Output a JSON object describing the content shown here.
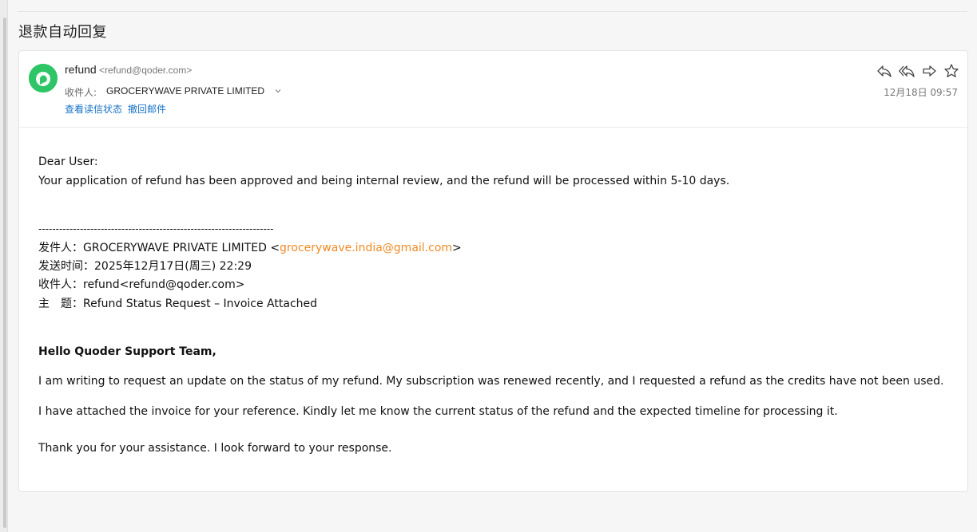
{
  "subject": "退款自动回复",
  "header": {
    "sender_name": "refund",
    "sender_address": "<refund@qoder.com>",
    "to_label": "收件人:",
    "to_value": "GROCERYWAVE PRIVATE LIMITED",
    "read_status_link": "查看读信状态",
    "recall_link": "撤回邮件",
    "date": "12月18日 09:57",
    "avatar_color": "#2ec567",
    "actions": [
      "reply-icon",
      "reply-all-icon",
      "forward-icon",
      "star-icon"
    ]
  },
  "body": {
    "greeting": "Dear User:",
    "message": "Your application of refund has been approved and being internal review, and the refund will be processed within 5-10 days.",
    "separator": "--------------------------------------------------------------------",
    "quoted": {
      "from_prefix": "发件人：GROCERYWAVE PRIVATE LIMITED <",
      "from_email": "grocerywave.india@gmail.com",
      "from_suffix": ">",
      "sent": "发送时间：2025年12月17日(周三) 22:29",
      "to": "收件人：refund<refund@qoder.com>",
      "subject": "主　题：Refund Status Request – Invoice Attached"
    },
    "original_greeting": "Hello Quoder Support Team,",
    "para1": "I am writing to request an update on the status of my refund. My subscription was renewed recently, and I requested a refund as the credits have not been used.",
    "para2": "I have attached the invoice for your reference. Kindly let me know the current status of the refund and the expected timeline for processing it.",
    "para3": "Thank you for your assistance. I look forward to your response."
  },
  "colors": {
    "link": "#1a73c8",
    "email_highlight": "#f08a24"
  }
}
